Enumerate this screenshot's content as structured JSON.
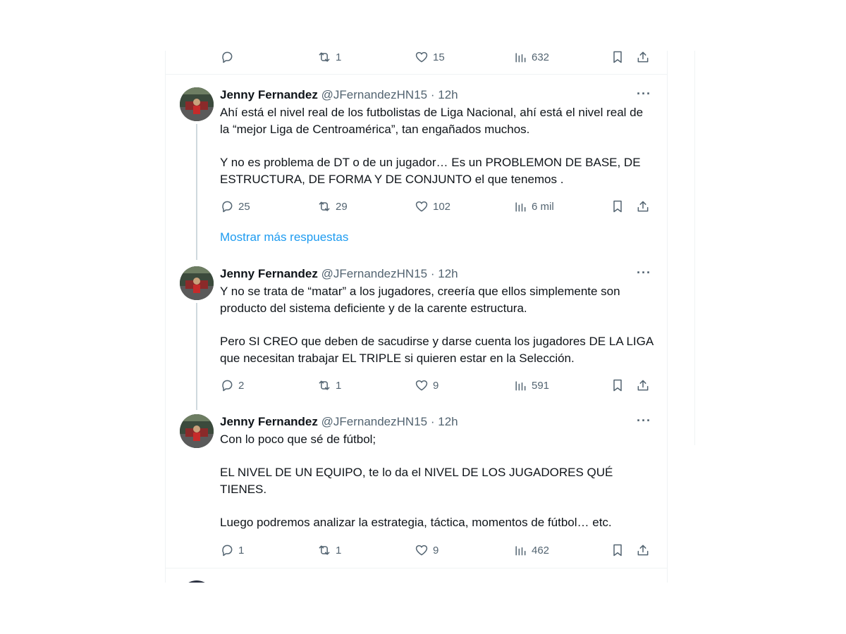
{
  "accent_color": "#1d9bf0",
  "top_tweet": {
    "actions": {
      "replies": "",
      "retweets": "1",
      "likes": "15",
      "views": "632"
    }
  },
  "tweets": [
    {
      "name": "Jenny Fernandez",
      "handle": "@JFernandezHN15",
      "dot": "·",
      "time": "12h",
      "more": "···",
      "paragraphs": [
        "Ahí está el nivel real de los futbolistas de Liga Nacional, ahí está el nivel real de la “mejor Liga de Centroamérica”, tan engañados muchos.",
        "Y no es problema de DT o de un jugador… Es un PROBLEMON DE BASE, DE ESTRUCTURA, DE FORMA Y DE CONJUNTO el que tenemos ."
      ],
      "actions": {
        "replies": "25",
        "retweets": "29",
        "likes": "102",
        "views": "6 mil"
      }
    },
    {
      "name": "Jenny Fernandez",
      "handle": "@JFernandezHN15",
      "dot": "·",
      "time": "12h",
      "more": "···",
      "paragraphs": [
        "Y no se trata de “matar” a los jugadores, creería que ellos simplemente son producto del sistema deficiente y de la carente estructura.",
        "Pero SI CREO que deben de sacudirse y darse cuenta los jugadores DE LA LIGA que necesitan trabajar EL TRIPLE si quieren estar en la Selección."
      ],
      "actions": {
        "replies": "2",
        "retweets": "1",
        "likes": "9",
        "views": "591"
      }
    },
    {
      "name": "Jenny Fernandez",
      "handle": "@JFernandezHN15",
      "dot": "·",
      "time": "12h",
      "more": "···",
      "paragraphs": [
        "Con lo poco que sé de fútbol;",
        "EL NIVEL DE UN EQUIPO, te lo da el NIVEL DE LOS JUGADORES QUÉ TIENES.",
        "Luego podremos analizar la estrategia, táctica, momentos de fútbol… etc."
      ],
      "actions": {
        "replies": "1",
        "retweets": "1",
        "likes": "9",
        "views": "462"
      }
    }
  ],
  "show_more_replies": "Mostrar más respuestas",
  "icons": {
    "reply": "reply-icon",
    "retweet": "retweet-icon",
    "like": "heart-icon",
    "views": "views-icon",
    "bookmark": "bookmark-icon",
    "share": "share-icon"
  }
}
